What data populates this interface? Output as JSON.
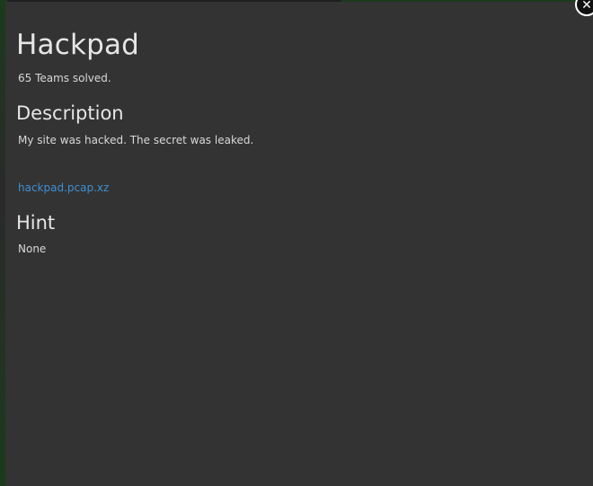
{
  "challenge": {
    "title": "Hackpad",
    "solved_text": "65 Teams solved."
  },
  "description": {
    "heading": "Description",
    "text": "My site was hacked. The secret was leaked."
  },
  "attachment": {
    "filename": "hackpad.pcap.xz"
  },
  "hint": {
    "heading": "Hint",
    "text": "None"
  },
  "close_button": {
    "icon": "close-icon",
    "glyph": "✕"
  },
  "colors": {
    "modal_background": "#333333",
    "link": "#3f8fd0",
    "text": "#d8d8d8"
  }
}
